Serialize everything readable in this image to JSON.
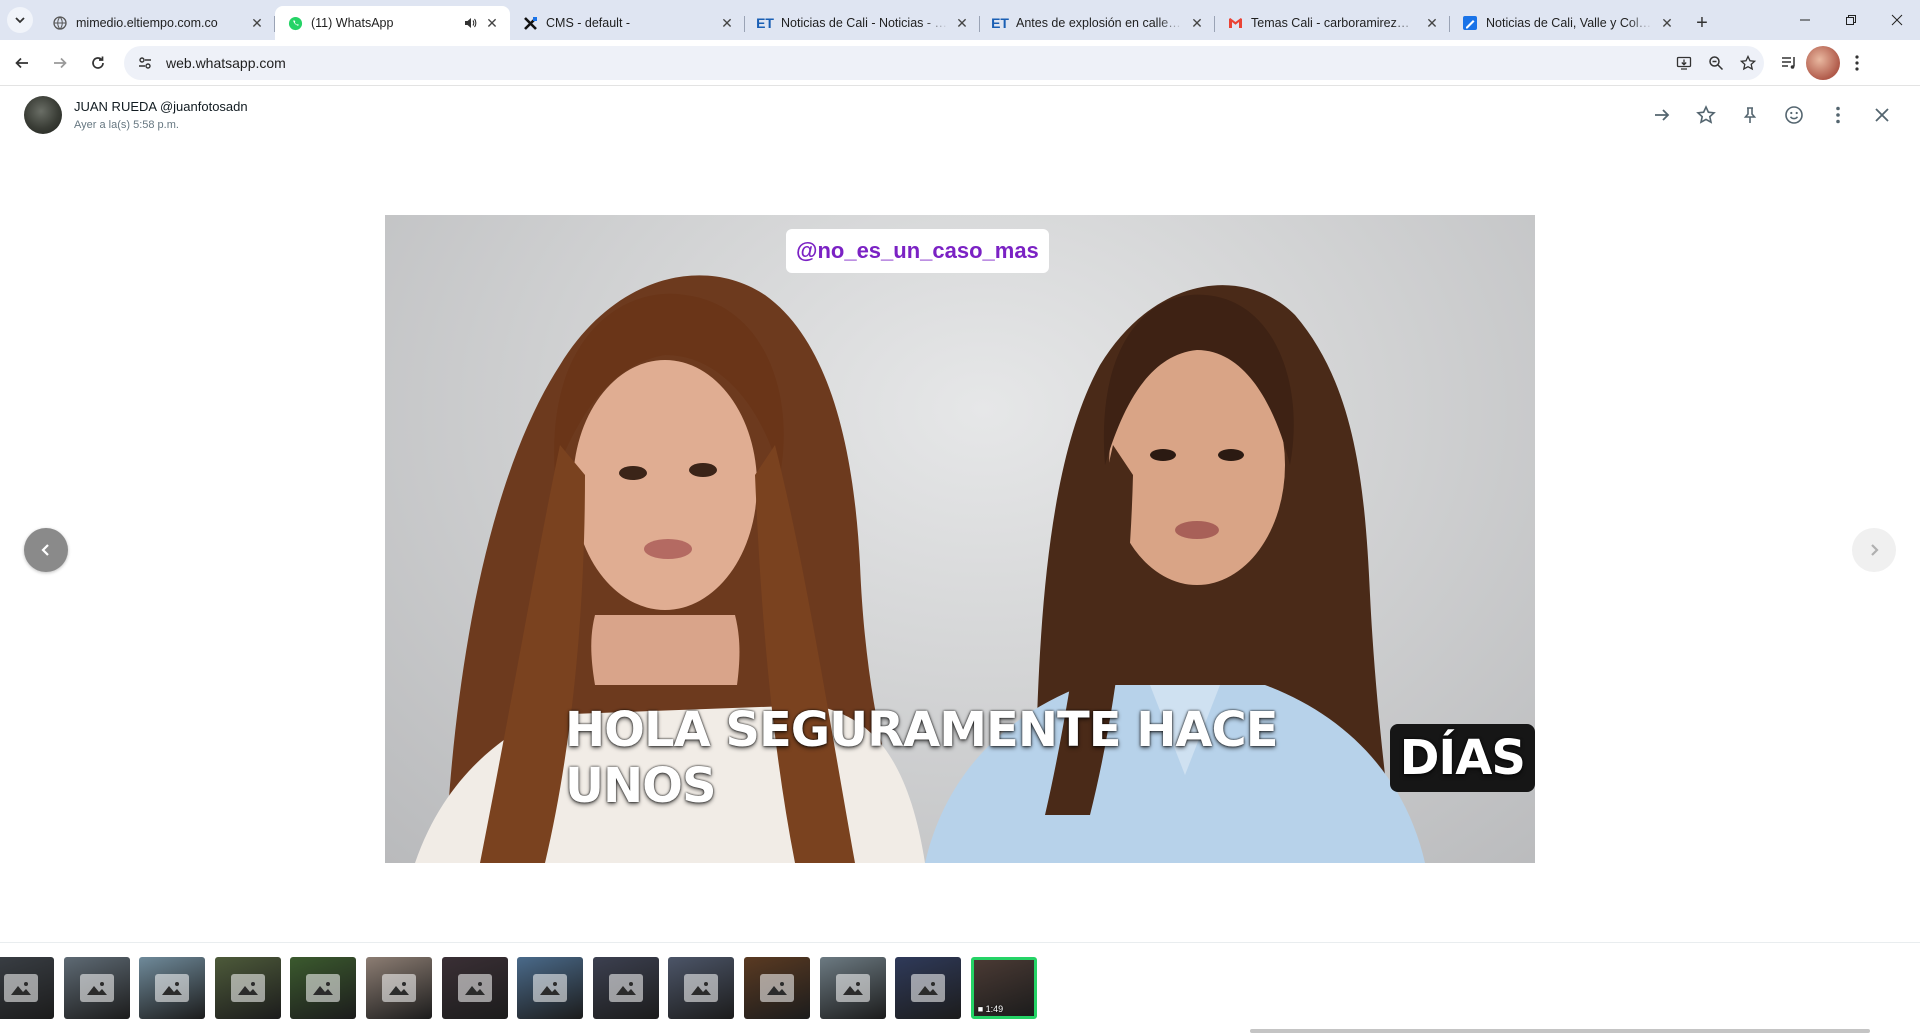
{
  "browser": {
    "tabs": [
      {
        "title": "mimedio.eltiempo.com.co",
        "favicon": "globe-icon",
        "active": false
      },
      {
        "title": "(11) WhatsApp",
        "favicon": "whatsapp-icon",
        "active": true
      },
      {
        "title": "CMS - default -",
        "favicon": "cms-x-icon",
        "active": false
      },
      {
        "title": "Noticias de Cali - Noticias - ELTIEMPO",
        "favicon": "et-icon",
        "active": false
      },
      {
        "title": "Antes de explosión en calle de Cali",
        "favicon": "et-icon",
        "active": false
      },
      {
        "title": "Temas Cali - carboramirez@gmail.com",
        "favicon": "gmail-icon",
        "active": false
      },
      {
        "title": "Noticias de Cali, Valle y Colombia",
        "favicon": "blue-pen-icon",
        "active": false
      }
    ],
    "url": "web.whatsapp.com"
  },
  "viewer": {
    "sender_name": "JUAN RUEDA @juanfotosadn",
    "sender_time": "Ayer a la(s) 5:58 p.m.",
    "media": {
      "handle_text": "@no_es_un_caso_mas",
      "caption_plain": "HOLA SEGURAMENTE HACE UNOS",
      "caption_highlight": "DÍAS"
    },
    "thumbnails": [
      {
        "kind": "image",
        "tint": "#3a3f45"
      },
      {
        "kind": "image",
        "tint": "#5e6a74"
      },
      {
        "kind": "image",
        "tint": "#6f8a9a"
      },
      {
        "kind": "image",
        "tint": "#4d5a3a"
      },
      {
        "kind": "image",
        "tint": "#3b5a2e"
      },
      {
        "kind": "image",
        "tint": "#8c7d73"
      },
      {
        "kind": "image",
        "tint": "#3a2f35"
      },
      {
        "kind": "image",
        "tint": "#4a6a8a"
      },
      {
        "kind": "image",
        "tint": "#3c4050"
      },
      {
        "kind": "image",
        "tint": "#4c5568"
      },
      {
        "kind": "image",
        "tint": "#5a3a22"
      },
      {
        "kind": "image",
        "tint": "#6c7a82"
      },
      {
        "kind": "image",
        "tint": "#2f3a5a"
      },
      {
        "kind": "video",
        "tint": "#4a3a34",
        "duration": "1:49"
      }
    ]
  },
  "colors": {
    "accent": "#25d366",
    "handle": "#7b22c4"
  }
}
